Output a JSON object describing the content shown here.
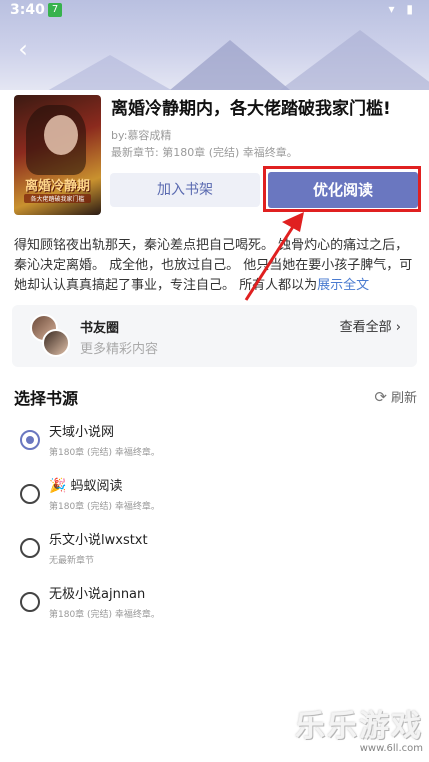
{
  "status_bar": {
    "time": "3:40",
    "app_badge": "7",
    "icons": "▾ ▮"
  },
  "nav": {
    "back_icon": "‹"
  },
  "book": {
    "cover_title": "离婚冷静期",
    "cover_subtitle": "各大佬踏破我家门槛",
    "title": "离婚冷静期内，各大佬踏破我家门槛!",
    "author": "by:慕容成精",
    "latest": "最新章节: 第180章 (完结) 幸福终章。"
  },
  "actions": {
    "add_shelf": "加入书架",
    "optimize": "优化阅读"
  },
  "synopsis": {
    "text": "得知顾铭夜出轨那天，秦沁差点把自己喝死。 蚀骨灼心的痛过之后，秦沁决定离婚。 成全他，也放过自己。 他只当她在要小孩子脾气，可她却认认真真搞起了事业，专注自己。 所有人都以为",
    "more": "展示全文"
  },
  "book_circle": {
    "title": "书友圈",
    "subtitle": "更多精彩内容",
    "view_all": "查看全部 ›"
  },
  "sources": {
    "header": "选择书源",
    "refresh_label": "刷新",
    "refresh_icon": "⟳",
    "items": [
      {
        "name": "天域小说网",
        "latest": "第180章 (完结) 幸福终章。",
        "selected": true,
        "icon": ""
      },
      {
        "name": "蚂蚁阅读",
        "latest": "第180章 (完结) 幸福终章。",
        "selected": false,
        "icon": "🎉"
      },
      {
        "name": "乐文小说lwxstxt",
        "latest": "无最新章节",
        "selected": false,
        "icon": ""
      },
      {
        "name": "无极小说ajnnan",
        "latest": "第180章 (完结) 幸福终章。",
        "selected": false,
        "icon": ""
      }
    ]
  },
  "watermark": {
    "brand": "乐乐游戏",
    "url": "www.6ll.com"
  },
  "colors": {
    "accent": "#6a77c0",
    "highlight": "#e02020",
    "link": "#4a7bd0"
  }
}
